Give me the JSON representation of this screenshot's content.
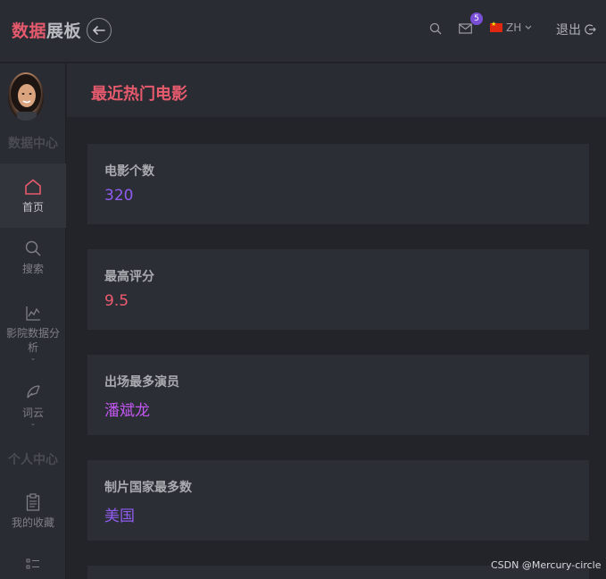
{
  "brand": {
    "part1": "数据",
    "part2": "展板"
  },
  "header": {
    "badge_count": "5",
    "lang": "ZH",
    "logout": "退出"
  },
  "sidebar": {
    "section1": "数据中心",
    "section2": "个人中心",
    "items": [
      {
        "label": "首页",
        "icon": "home-icon"
      },
      {
        "label": "搜索",
        "icon": "search-icon"
      },
      {
        "label": "影院数据分析",
        "icon": "chart-icon"
      },
      {
        "label": "词云",
        "icon": "feather-icon"
      },
      {
        "label": "我的收藏",
        "icon": "clipboard-icon"
      }
    ]
  },
  "page": {
    "title": "最近热门电影"
  },
  "cards": [
    {
      "label": "电影个数",
      "value": "320",
      "color": "#8f5cf0"
    },
    {
      "label": "最高评分",
      "value": "9.5",
      "color": "#ee5a70"
    },
    {
      "label": "出场最多演员",
      "value": "潘斌龙",
      "color": "#c257f0"
    },
    {
      "label": "制片国家最多数",
      "value": "美国",
      "color": "#8f5cf0"
    }
  ],
  "watermark": "CSDN @Mercury-circle"
}
